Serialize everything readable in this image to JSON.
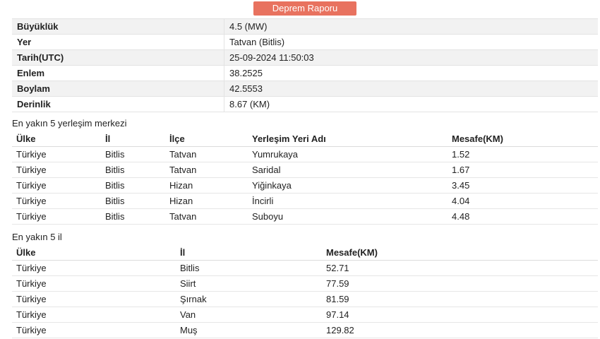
{
  "report_button": "Deprem Raporu",
  "details": [
    {
      "label": "Büyüklük",
      "value": "4.5 (MW)"
    },
    {
      "label": "Yer",
      "value": "Tatvan (Bitlis)"
    },
    {
      "label": "Tarih(UTC)",
      "value": "25-09-2024 11:50:03"
    },
    {
      "label": "Enlem",
      "value": "38.2525"
    },
    {
      "label": "Boylam",
      "value": "42.5553"
    },
    {
      "label": "Derinlik",
      "value": "8.67 (KM)"
    }
  ],
  "settlements": {
    "title": "En yakın 5 yerleşim merkezi",
    "headers": [
      "Ülke",
      "İl",
      "İlçe",
      "Yerleşim Yeri Adı",
      "Mesafe(KM)"
    ],
    "rows": [
      [
        "Türkiye",
        "Bitlis",
        "Tatvan",
        "Yumrukaya",
        "1.52"
      ],
      [
        "Türkiye",
        "Bitlis",
        "Tatvan",
        "Saridal",
        "1.67"
      ],
      [
        "Türkiye",
        "Bitlis",
        "Hizan",
        "Yiğinkaya",
        "3.45"
      ],
      [
        "Türkiye",
        "Bitlis",
        "Hizan",
        "İncirli",
        "4.04"
      ],
      [
        "Türkiye",
        "Bitlis",
        "Tatvan",
        "Suboyu",
        "4.48"
      ]
    ]
  },
  "provinces": {
    "title": "En yakın 5 il",
    "headers": [
      "Ülke",
      "İl",
      "Mesafe(KM)"
    ],
    "rows": [
      [
        "Türkiye",
        "Bitlis",
        "52.71"
      ],
      [
        "Türkiye",
        "Siirt",
        "77.59"
      ],
      [
        "Türkiye",
        "Şırnak",
        "81.59"
      ],
      [
        "Türkiye",
        "Van",
        "97.14"
      ],
      [
        "Türkiye",
        "Muş",
        "129.82"
      ]
    ]
  }
}
